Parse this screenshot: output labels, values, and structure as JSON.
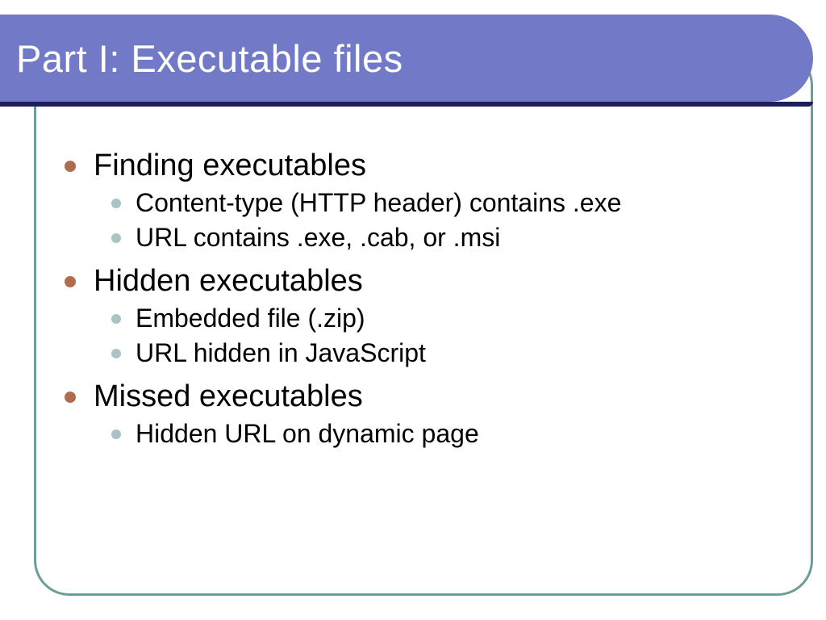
{
  "colors": {
    "title_bar": "#7279c6",
    "title_underline": "#1d1f5a",
    "frame_border": "#6b9d9a",
    "bullet_l1": "#b06d4e",
    "bullet_l2": "#a9c4c3"
  },
  "title": "Part I: Executable files",
  "bullets": [
    {
      "text": "Finding executables",
      "sub": [
        "Content-type (HTTP header) contains .exe",
        "URL contains .exe, .cab, or .msi"
      ]
    },
    {
      "text": "Hidden executables",
      "sub": [
        "Embedded file (.zip)",
        "URL hidden in JavaScript"
      ]
    },
    {
      "text": "Missed executables",
      "sub": [
        "Hidden URL on dynamic page"
      ]
    }
  ]
}
